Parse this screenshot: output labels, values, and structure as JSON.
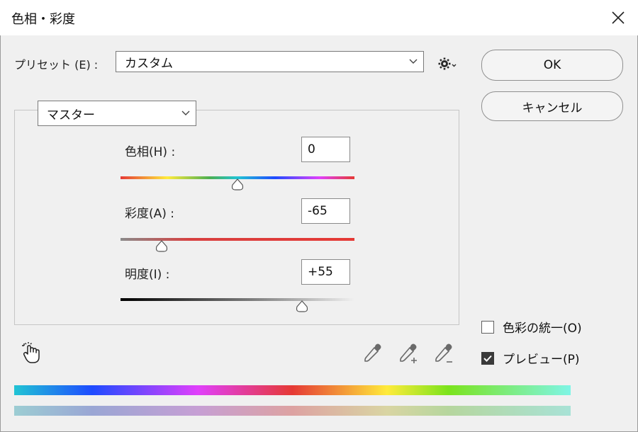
{
  "window": {
    "title": "色相・彩度"
  },
  "preset": {
    "label": "プリセット (E) :",
    "value": "カスタム"
  },
  "buttons": {
    "ok": "OK",
    "cancel": "キャンセル"
  },
  "channel": {
    "value": "マスター"
  },
  "adjustments": {
    "hue": {
      "label": "色相(H) :",
      "value": "0",
      "slider_fraction": 0.5
    },
    "saturation": {
      "label": "彩度(A) :",
      "value": "-65",
      "slider_fraction": 0.175
    },
    "lightness": {
      "label": "明度(I) :",
      "value": "+55",
      "slider_fraction": 0.775
    }
  },
  "options": {
    "colorize": {
      "label": "色彩の統一(O)",
      "checked": false
    },
    "preview": {
      "label": "プレビュー(P)",
      "checked": true
    }
  },
  "icons": [
    "close-icon",
    "gear-icon",
    "chevron-down-icon",
    "hand-adjust-icon",
    "eyedropper-icon",
    "eyedropper-add-icon",
    "eyedropper-subtract-icon",
    "check-icon"
  ]
}
